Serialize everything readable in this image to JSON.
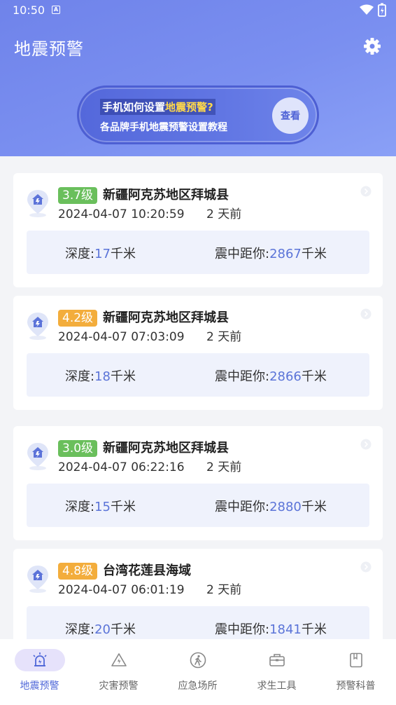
{
  "status_bar": {
    "time": "10:50",
    "notification_icon": "A"
  },
  "header": {
    "title": "地震预警",
    "settings_icon": "gear-icon"
  },
  "banner": {
    "line1_prefix": "手机如何设置",
    "line1_highlight": "地震预警",
    "line1_suffix": "?",
    "line2": "各品牌手机地震预警设置教程",
    "button_label": "查看"
  },
  "labels": {
    "depth": "深度:",
    "distance": "震中距你:",
    "unit": "千米"
  },
  "colors": {
    "green": "#6abf5c",
    "orange": "#f3ad3c",
    "accent": "#5068d8"
  },
  "events": [
    {
      "magnitude": "3.7级",
      "level": "green",
      "location": "新疆阿克苏地区拜城县",
      "time": "2024-04-07 10:20:59",
      "ago": "2 天前",
      "depth": "17",
      "distance": "2867"
    },
    {
      "magnitude": "4.2级",
      "level": "orange",
      "location": "新疆阿克苏地区拜城县",
      "time": "2024-04-07 07:03:09",
      "ago": "2 天前",
      "depth": "18",
      "distance": "2866"
    },
    {
      "magnitude": "3.0级",
      "level": "green",
      "location": "新疆阿克苏地区拜城县",
      "time": "2024-04-07 06:22:16",
      "ago": "2 天前",
      "depth": "15",
      "distance": "2880"
    },
    {
      "magnitude": "4.8级",
      "level": "orange",
      "location": "台湾花莲县海域",
      "time": "2024-04-07 06:01:19",
      "ago": "2 天前",
      "depth": "20",
      "distance": "1841"
    }
  ],
  "tabs": [
    {
      "label": "地震预警",
      "icon": "alarm-icon",
      "active": true
    },
    {
      "label": "灾害预警",
      "icon": "warning-triangle-icon",
      "active": false
    },
    {
      "label": "应急场所",
      "icon": "walking-person-icon",
      "active": false
    },
    {
      "label": "求生工具",
      "icon": "toolbox-icon",
      "active": false
    },
    {
      "label": "预警科普",
      "icon": "book-icon",
      "active": false
    }
  ]
}
